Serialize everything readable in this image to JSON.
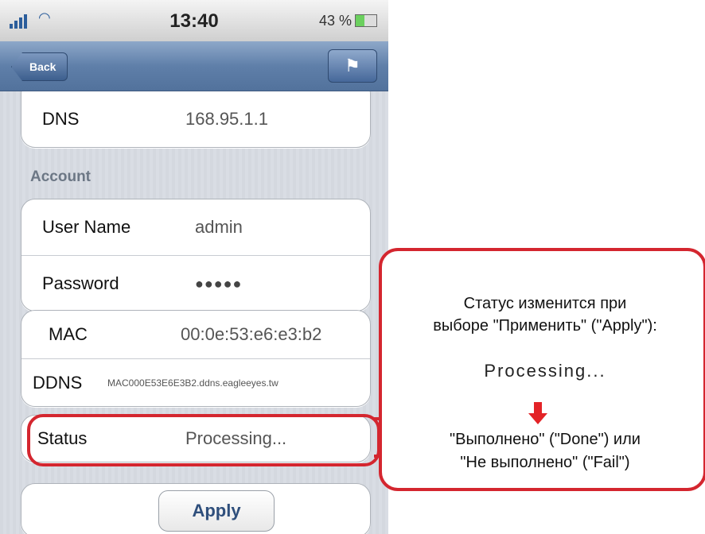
{
  "statusbar": {
    "time": "13:40",
    "battery": "43 %"
  },
  "navbar": {
    "back_label": "Back"
  },
  "network": {
    "rows": [
      {
        "label": "DNS",
        "value": "168.95.1.1"
      }
    ]
  },
  "account": {
    "section_title": "Account",
    "user_name_label": "User Name",
    "user_name_value": "admin",
    "password_label": "Password",
    "password_value": "●●●●●"
  },
  "device": {
    "mac_label": "MAC",
    "mac_value": "00:0e:53:e6:e3:b2",
    "ddns_label": "DDNS",
    "ddns_value": "MAC000E53E6E3B2.ddns.eagleeyes.tw"
  },
  "status": {
    "label": "Status",
    "value": "Processing..."
  },
  "apply": {
    "label": "Apply"
  },
  "callout": {
    "line1": "Статус изменится при",
    "line2": "выборе \"Применить\" (\"Apply\"):",
    "processing": "Processing...",
    "line3": "\"Выполнено\" (\"Done\") или",
    "line4": "\"Не выполнено\" (\"Fail\")"
  },
  "colors": {
    "accent_red": "#d4262f",
    "nav_blue": "#5f7fa9"
  },
  "icons": [
    "signal-icon",
    "wifi-icon",
    "battery-icon",
    "book-icon",
    "down-arrow-icon"
  ]
}
